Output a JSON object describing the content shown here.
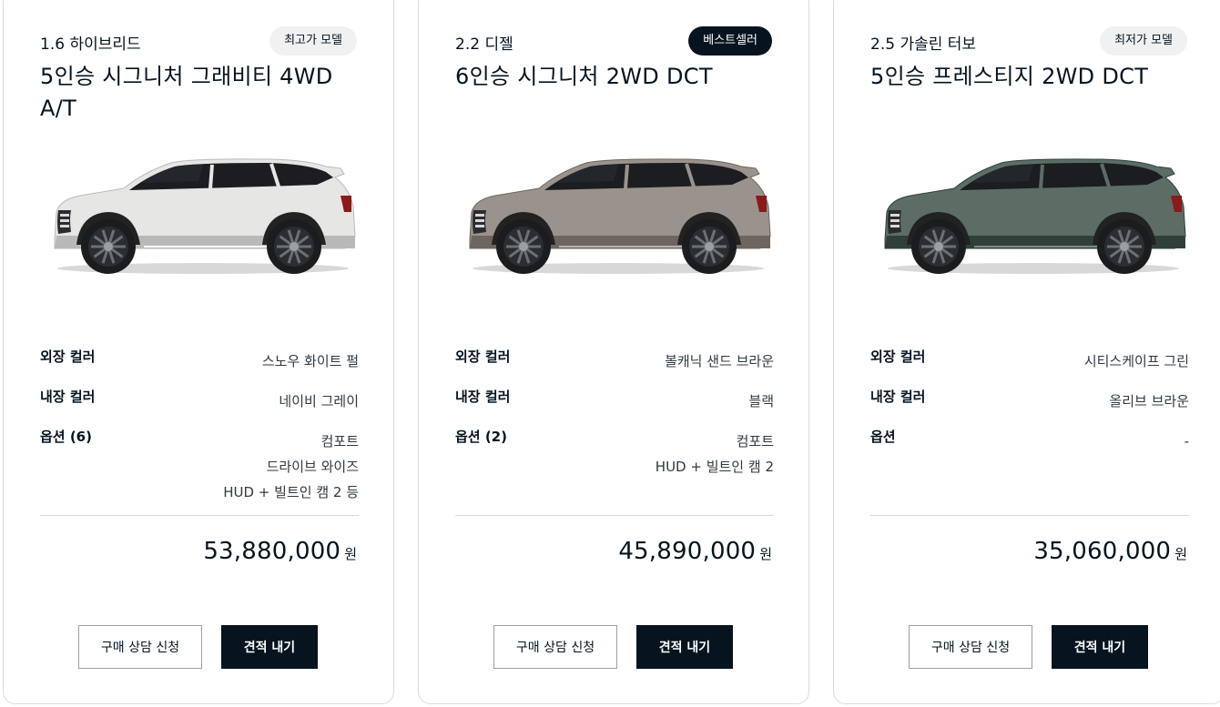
{
  "colors": {
    "primary_dark": "#05141f",
    "badge_light": "#f1f1f1",
    "border": "#d9dadc"
  },
  "cards": [
    {
      "engine": "1.6 하이브리드",
      "badge": "최고가 모델",
      "badge_style": "light",
      "model": "5인승 시그니처 그래비티 4WD A/T",
      "car_color_name": "white",
      "car_body_color": "#e6e6e4",
      "spec_labels": {
        "exterior": "외장 컬러",
        "interior": "내장 컬러",
        "options": "옵션 (6)"
      },
      "exterior_color": "스노우 화이트 펄",
      "interior_color": "네이비 그레이",
      "options": [
        "컴포트",
        "드라이브 와이즈",
        "HUD + 빌트인 캠 2 등"
      ],
      "price": "53,880,000",
      "currency": "원",
      "consult_label": "구매 상담 신청",
      "quote_label": "견적 내기"
    },
    {
      "engine": "2.2 디젤",
      "badge": "베스트셀러",
      "badge_style": "dark",
      "model": "6인승 시그니처 2WD DCT",
      "car_color_name": "sand-brown",
      "car_body_color": "#9a928c",
      "spec_labels": {
        "exterior": "외장 컬러",
        "interior": "내장 컬러",
        "options": "옵션 (2)"
      },
      "exterior_color": "볼캐닉 샌드 브라운",
      "interior_color": "블랙",
      "options": [
        "컴포트",
        "HUD + 빌트인 캠 2"
      ],
      "price": "45,890,000",
      "currency": "원",
      "consult_label": "구매 상담 신청",
      "quote_label": "견적 내기"
    },
    {
      "engine": "2.5 가솔린 터보",
      "badge": "최저가 모델",
      "badge_style": "light",
      "model": "5인승 프레스티지 2WD DCT",
      "car_color_name": "green",
      "car_body_color": "#5c6d65",
      "spec_labels": {
        "exterior": "외장 컬러",
        "interior": "내장 컬러",
        "options": "옵션"
      },
      "exterior_color": "시티스케이프 그린",
      "interior_color": "올리브 브라운",
      "options": [
        "-"
      ],
      "price": "35,060,000",
      "currency": "원",
      "consult_label": "구매 상담 신청",
      "quote_label": "견적 내기"
    }
  ]
}
